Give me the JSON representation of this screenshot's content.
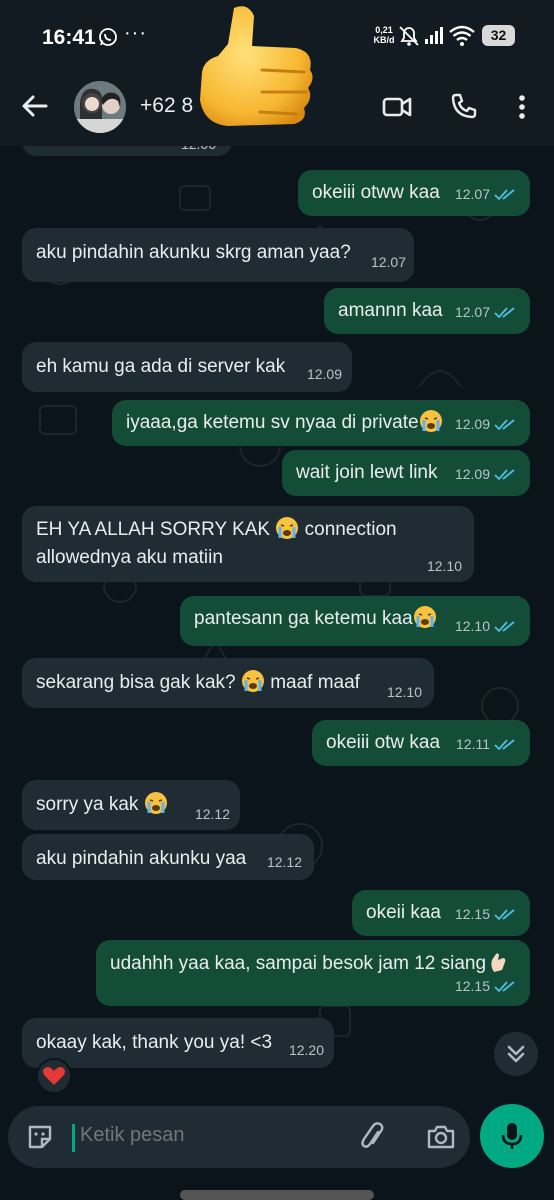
{
  "status": {
    "time": "16:41",
    "dots": "···",
    "net_speed_top": "0,21",
    "net_speed_unit": "KB/d",
    "battery": "32"
  },
  "header": {
    "contact": "+62 8"
  },
  "messages": [
    {
      "dir": "in",
      "text": "",
      "time": "12.06"
    },
    {
      "dir": "out",
      "text": "okeiii otww kaa",
      "time": "12.07"
    },
    {
      "dir": "in",
      "text": "aku pindahin akunku skrg aman yaa?",
      "time": "12.07"
    },
    {
      "dir": "out",
      "text": "amannn kaa",
      "time": "12.07"
    },
    {
      "dir": "in",
      "text": "eh kamu ga ada di server kak",
      "time": "12.09"
    },
    {
      "dir": "out",
      "text": "iyaaa,ga ketemu sv nyaa di private",
      "time": "12.09"
    },
    {
      "dir": "out",
      "text": "wait join lewt link",
      "time": "12.09"
    },
    {
      "dir": "in",
      "text_line1": "EH YA ALLAH SORRY KAK",
      "text_line1b": "connection",
      "text_line2": "allowednya aku matiin",
      "time": "12.10"
    },
    {
      "dir": "out",
      "text": "pantesann ga ketemu kaa",
      "time": "12.10"
    },
    {
      "dir": "in",
      "text": "sekarang bisa gak kak?",
      "text_after": "maaf maaf",
      "time": "12.10"
    },
    {
      "dir": "out",
      "text": "okeiii otw kaa",
      "time": "12.11"
    },
    {
      "dir": "in",
      "text": "sorry ya kak",
      "time": "12.12"
    },
    {
      "dir": "in",
      "text": "aku pindahin akunku yaa",
      "time": "12.12"
    },
    {
      "dir": "out",
      "text": "okeii kaa",
      "time": "12.15"
    },
    {
      "dir": "out",
      "text": "udahhh yaa kaa, sampai besok jam 12 siang",
      "time": "12.15"
    },
    {
      "dir": "in",
      "text": "okaay kak, thank you ya! <3",
      "time": "12.20"
    }
  ],
  "input": {
    "placeholder": "Ketik pesan"
  },
  "colors": {
    "outgoing": "#144d37",
    "incoming": "#202c33",
    "accent": "#00a884",
    "tick": "#53bdeb"
  },
  "icons": [
    "back-arrow-icon",
    "video-call-icon",
    "phone-icon",
    "more-vert-icon",
    "sticker-icon",
    "attach-icon",
    "camera-icon",
    "mic-icon",
    "double-chevron-down-icon",
    "heart-icon",
    "crying-emoji-icon",
    "thumbs-up-sticker"
  ]
}
